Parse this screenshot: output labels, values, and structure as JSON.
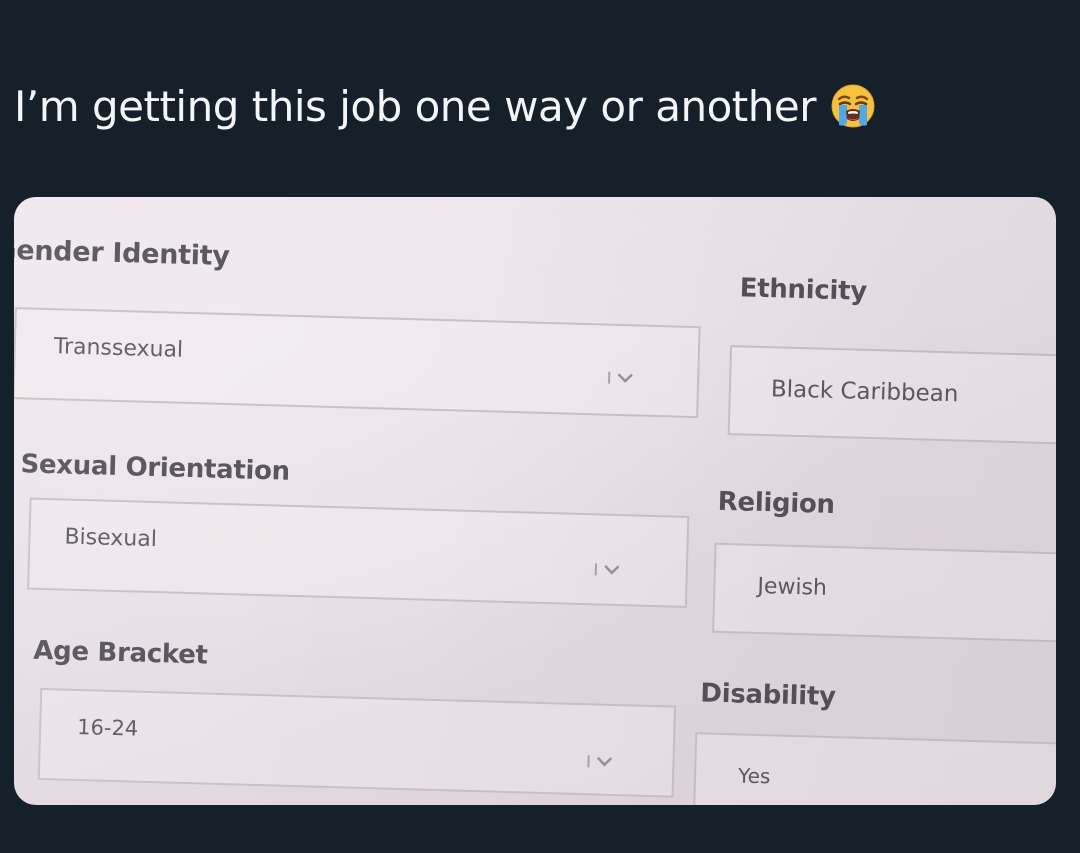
{
  "post": {
    "caption": "I’m getting this job one way or another",
    "emoji": "loudly-crying-face-emoji"
  },
  "form": {
    "gender_identity": {
      "label": "Gender Identity",
      "value": "Transsexual"
    },
    "sexual_orientation": {
      "label": "Sexual Orientation",
      "value": "Bisexual"
    },
    "age_bracket": {
      "label": "Age Bracket",
      "value": "16-24"
    },
    "ethnicity": {
      "label": "Ethnicity",
      "value": "Black Caribbean"
    },
    "religion": {
      "label": "Religion",
      "value": "Jewish"
    },
    "disability": {
      "label": "Disability",
      "value": "Yes"
    }
  },
  "colors": {
    "background": "#15202b",
    "caption_text": "#f4f5f6",
    "paper": "#e8e1e6",
    "form_text": "#55505a"
  }
}
